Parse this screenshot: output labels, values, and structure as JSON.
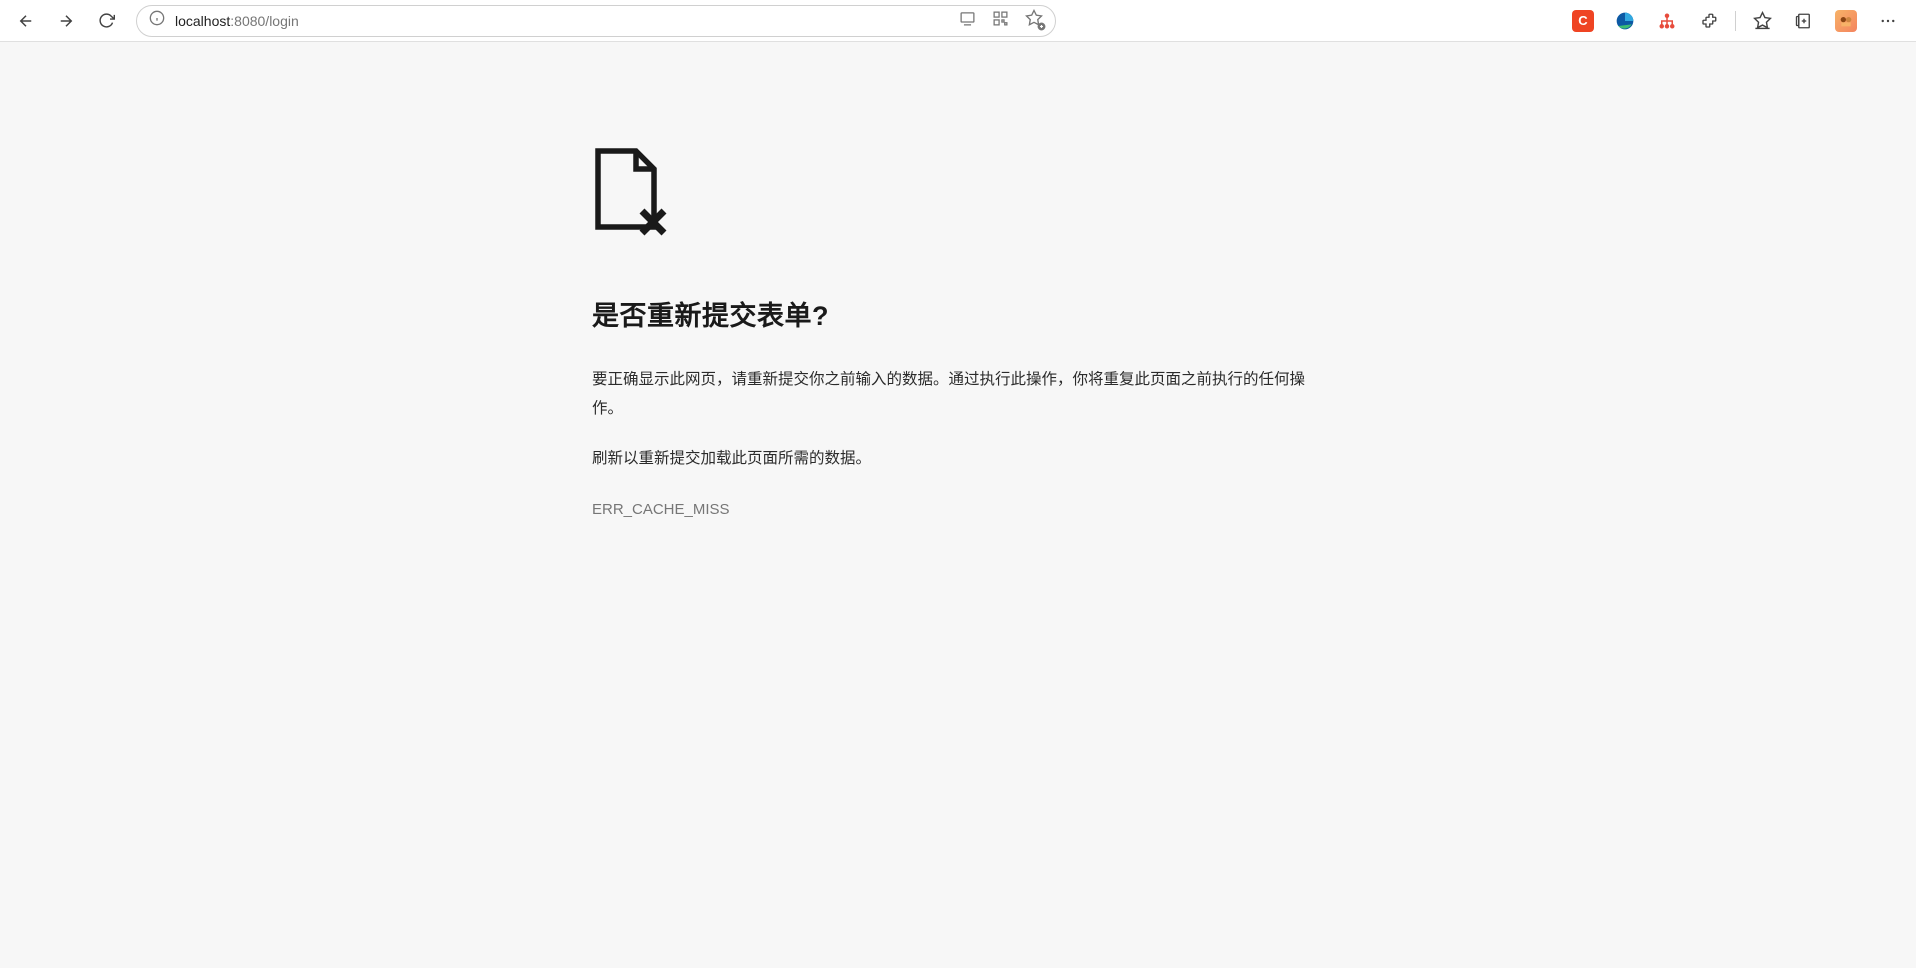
{
  "toolbar": {
    "url_host": "localhost",
    "url_path": ":8080/login"
  },
  "error": {
    "title": "是否重新提交表单?",
    "desc1": "要正确显示此网页，请重新提交你之前输入的数据。通过执行此操作，你将重复此页面之前执行的任何操作。",
    "desc2": "刷新以重新提交加载此页面所需的数据。",
    "code": "ERR_CACHE_MISS"
  },
  "ext": {
    "c_label": "C"
  }
}
